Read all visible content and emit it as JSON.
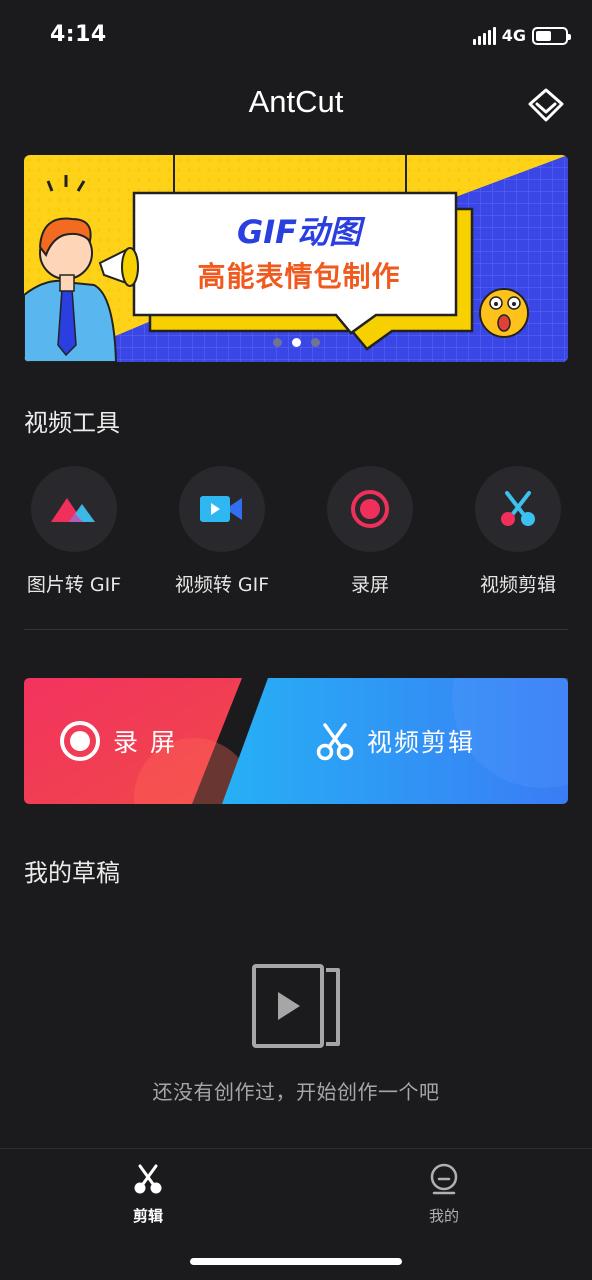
{
  "status_bar": {
    "time": "4:14",
    "network": "4G",
    "battery_level": 0.55
  },
  "header": {
    "title": "AntCut",
    "vip_icon": "diamond-icon"
  },
  "banner": {
    "line1": "GIF动图",
    "line2": "高能表情包制作",
    "slides": 3,
    "active_slide": 2
  },
  "video_tools": {
    "title": "视频工具",
    "items": [
      {
        "label": "图片转 GIF",
        "icon": "mountain-image-icon"
      },
      {
        "label": "视频转 GIF",
        "icon": "video-camera-icon"
      },
      {
        "label": "录屏",
        "icon": "record-icon"
      },
      {
        "label": "视频剪辑",
        "icon": "scissors-icon"
      }
    ]
  },
  "actions": {
    "record_label": "录 屏",
    "edit_label": "视频剪辑",
    "record_color": "#f0305a",
    "edit_color": "#2f8cf6"
  },
  "drafts": {
    "title": "我的草稿",
    "empty_text": "还没有创作过，开始创作一个吧"
  },
  "tab_bar": {
    "tabs": [
      {
        "label": "剪辑",
        "icon": "scissors-icon",
        "active": true
      },
      {
        "label": "我的",
        "icon": "profile-icon",
        "active": false
      }
    ]
  }
}
